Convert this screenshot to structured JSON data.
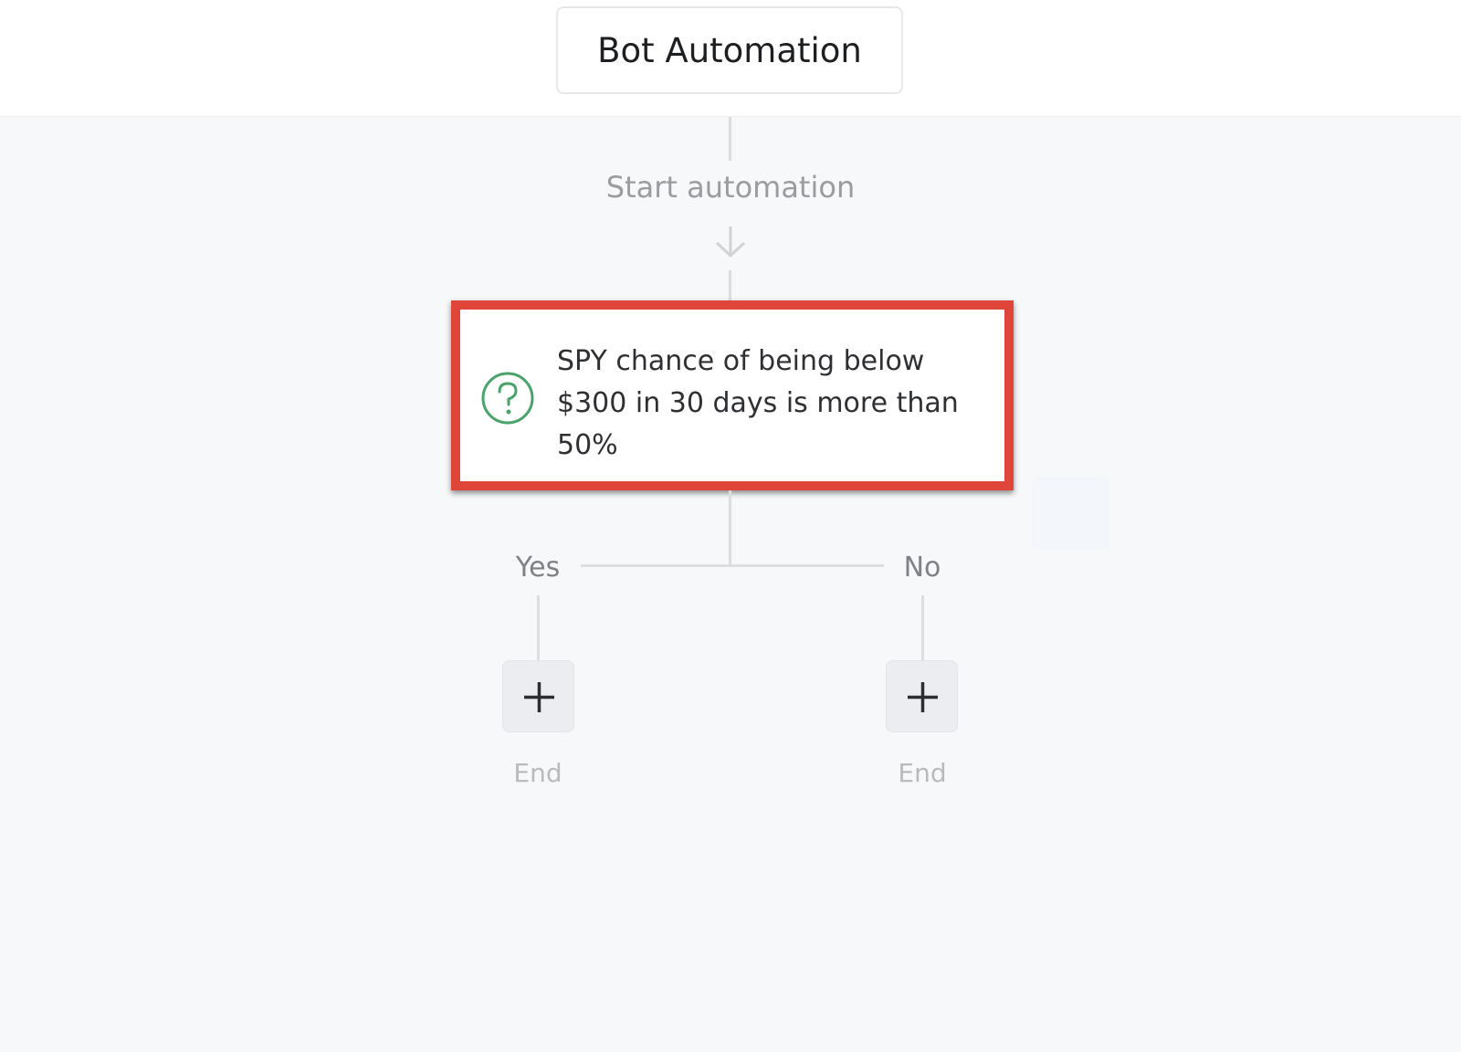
{
  "header": {
    "title": "Bot Automation"
  },
  "flow": {
    "start_label": "Start automation",
    "condition": {
      "text": "SPY chance of being below $300 in 30 days is more than 50%",
      "icon": "question-circle-icon",
      "highlight_color": "#e0453a",
      "icon_color": "#4aa36a"
    },
    "branches": [
      {
        "label": "Yes",
        "add_icon": "plus-icon",
        "end_label": "End"
      },
      {
        "label": "No",
        "add_icon": "plus-icon",
        "end_label": "End"
      }
    ]
  }
}
